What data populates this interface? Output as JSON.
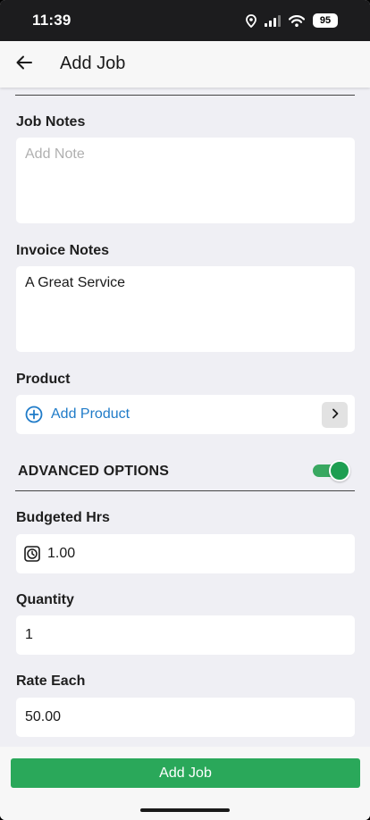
{
  "status_bar": {
    "time": "11:39",
    "battery": "95"
  },
  "header": {
    "title": "Add Job",
    "back_icon": "arrow-left-icon"
  },
  "form": {
    "job_notes": {
      "label": "Job Notes",
      "value": "",
      "placeholder": "Add Note"
    },
    "invoice_notes": {
      "label": "Invoice Notes",
      "value": "A Great Service",
      "placeholder": ""
    },
    "product": {
      "label": "Product",
      "add_label": "Add Product",
      "add_icon": "plus-circle-icon",
      "chevron_icon": "chevron-right-icon"
    },
    "advanced_options": {
      "title": "ADVANCED OPTIONS",
      "enabled": true
    },
    "budgeted_hrs": {
      "label": "Budgeted Hrs",
      "value": "1.00",
      "icon": "clock-icon"
    },
    "quantity": {
      "label": "Quantity",
      "value": "1"
    },
    "rate_each": {
      "label": "Rate Each",
      "value": "50.00"
    }
  },
  "footer": {
    "submit_label": "Add Job"
  },
  "colors": {
    "accent_blue": "#1f7bc8",
    "accent_green": "#2aa85a",
    "background": "#efeff4"
  }
}
